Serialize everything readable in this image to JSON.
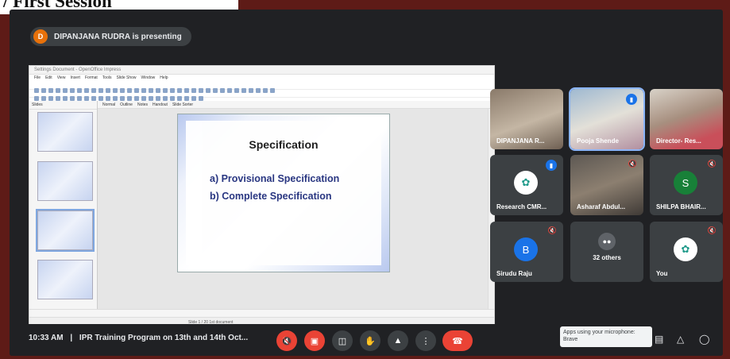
{
  "heading": "/ First Session",
  "presenter_bar": {
    "avatar_letter": "D",
    "text": "DIPANJANA RUDRA is presenting"
  },
  "presentation": {
    "window_title": "Settings Document - OpenOffice Impress",
    "menu": [
      "File",
      "Edit",
      "View",
      "Insert",
      "Format",
      "Tools",
      "Slide Show",
      "Window",
      "Help"
    ],
    "pane_label": "Slides",
    "view_tabs": [
      "Normal",
      "Outline",
      "Notes",
      "Handout",
      "Slide Sorter"
    ],
    "status_text": "Slide 1 / 20    1st document",
    "slide": {
      "title": "Specification",
      "lines": [
        "a) Provisional Specification",
        "b) Complete Specification"
      ]
    }
  },
  "participants": [
    {
      "name": "DIPANJANA R...",
      "type": "video"
    },
    {
      "name": "Pooja Shende",
      "type": "video",
      "speaking": true
    },
    {
      "name": "Director- Res...",
      "type": "video"
    },
    {
      "name": "Research CMR...",
      "type": "avatar",
      "speaking": true
    },
    {
      "name": "Asharaf Abdul...",
      "type": "video",
      "muted": true
    },
    {
      "name": "SHILPA BHAIR...",
      "type": "letter",
      "letter": "S",
      "color": "#188038",
      "muted": true
    },
    {
      "name": "Sirudu Raju",
      "type": "letter",
      "letter": "B",
      "color": "#1a73e8",
      "muted": true
    },
    {
      "name": "32 others",
      "type": "others"
    },
    {
      "name": "You",
      "type": "avatar",
      "muted": true
    }
  ],
  "bottom_bar": {
    "time": "10:33 AM",
    "separator": "|",
    "meeting_title": "IPR Training Program on 13th and 14th Oct...",
    "tooltip_line1": "Apps using your microphone:",
    "tooltip_line2": "Brave"
  }
}
